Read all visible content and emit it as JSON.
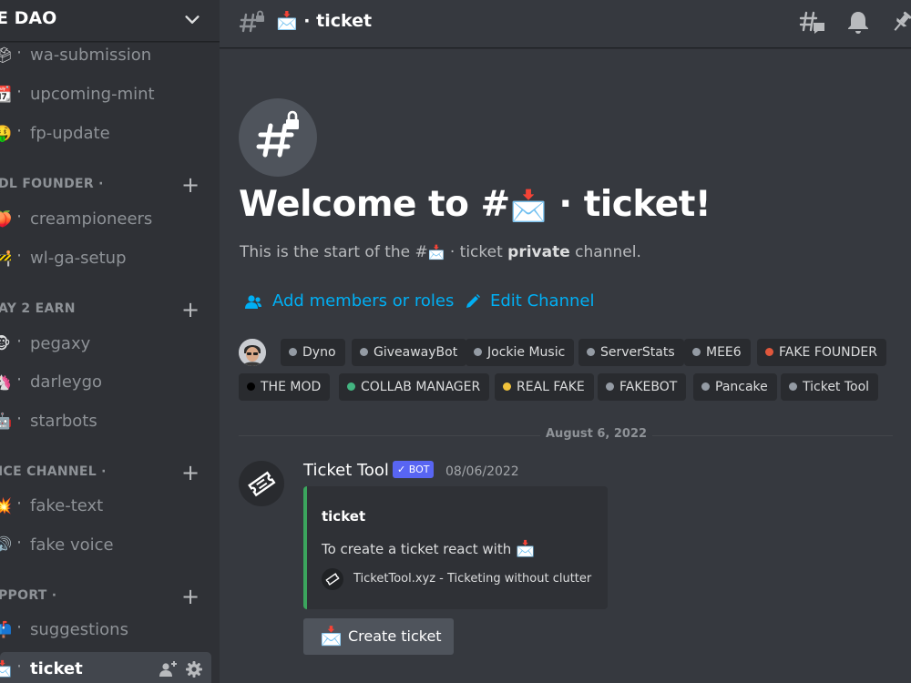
{
  "server": {
    "name": "E DAO"
  },
  "channels": [
    {
      "id": "wa-submission",
      "emoji": "🗳",
      "label": "wa-submission"
    },
    {
      "id": "upcoming-mint",
      "emoji": "📆",
      "label": "upcoming-mint"
    },
    {
      "id": "fp-update",
      "emoji": "🤑",
      "label": "fp-update"
    }
  ],
  "categories": {
    "founder": {
      "label": "DL FOUNDER ·"
    },
    "p2e": {
      "label": "AY 2 EARN"
    },
    "voice": {
      "label": "ICE CHANNEL ·"
    },
    "support": {
      "label": "PPORT  ·"
    }
  },
  "founder_channels": [
    {
      "emoji": "🍑",
      "label": "creampioneers"
    },
    {
      "emoji": "🚧",
      "label": "wl-ga-setup"
    }
  ],
  "p2e_channels": [
    {
      "emoji": "🐵",
      "label": "pegaxy"
    },
    {
      "emoji": "🦄",
      "label": "darleygo"
    },
    {
      "emoji": "🤖",
      "label": "starbots"
    }
  ],
  "voice_channels": [
    {
      "emoji": "💥",
      "label": "fake-text"
    },
    {
      "emoji": "🔊",
      "label": "fake voice"
    }
  ],
  "support_channels": [
    {
      "emoji": "📫",
      "label": "suggestions"
    },
    {
      "emoji": "📩",
      "label": "ticket"
    }
  ],
  "channel_dot": "·",
  "header": {
    "title_emoji": "📩",
    "title": "· ticket"
  },
  "welcome": {
    "heading_prefix": "Welcome to #",
    "heading_emoji": "📩",
    "heading_suffix": " · ticket!",
    "start_prefix": "This is the start of the #",
    "start_emoji": "📩",
    "start_mid": " · ticket ",
    "start_bold": "private",
    "start_suffix": " channel."
  },
  "actions": {
    "add_members": "Add members or roles",
    "edit_channel": "Edit Channel"
  },
  "roles": [
    {
      "name": "Dyno",
      "color": "#949ba4"
    },
    {
      "name": "GiveawayBot",
      "color": "#949ba4"
    },
    {
      "name": "Jockie Music",
      "color": "#949ba4"
    },
    {
      "name": "ServerStats",
      "color": "#949ba4"
    },
    {
      "name": "MEE6",
      "color": "#949ba4"
    },
    {
      "name": "FAKE FOUNDER",
      "color": "#e0573c"
    },
    {
      "name": "THE MOD",
      "color": "#000000"
    },
    {
      "name": "COLLAB MANAGER",
      "color": "#43b581"
    },
    {
      "name": "REAL FAKE",
      "color": "#f0c23b"
    },
    {
      "name": "FAKEBOT",
      "color": "#949ba4"
    },
    {
      "name": "Pancake",
      "color": "#949ba4"
    },
    {
      "name": "Ticket Tool",
      "color": "#949ba4"
    }
  ],
  "date_divider": "August 6, 2022",
  "message": {
    "author": "Ticket Tool",
    "bot_tag": "✓ BOT",
    "timestamp": "08/06/2022",
    "embed_title": "ticket",
    "embed_desc": "To create a ticket react with",
    "embed_emoji": "📩",
    "footer": "TicketTool.xyz - Ticketing without clutter",
    "button_emoji": "📩",
    "button_label": "Create ticket"
  },
  "colors": {
    "link": "#00aff4",
    "bot_tag": "#5865f2",
    "embed_border": "#3ba55d"
  }
}
